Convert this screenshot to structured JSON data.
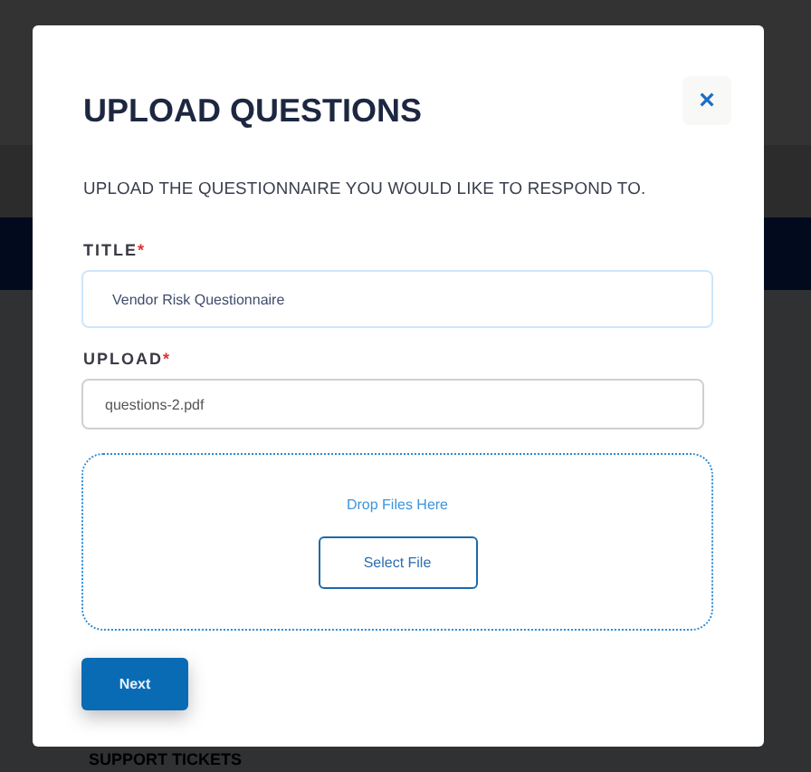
{
  "background": {
    "section_heading": "SUPPORT TICKETS"
  },
  "dialog": {
    "title": "UPLOAD QUESTIONS",
    "close": "×",
    "instructions": "UPLOAD THE QUESTIONNAIRE YOU WOULD LIKE TO RESPOND TO.",
    "fields": [
      {
        "label": "TITLE",
        "required_mark": "*",
        "value": "Vendor Risk Questionnaire",
        "focused": true
      },
      {
        "label": "UPLOAD",
        "required_mark": "*",
        "value": "questions-2.pdf",
        "focused": false
      }
    ],
    "dropzone": {
      "prompt": "Drop Files Here",
      "button": "Select File"
    },
    "submit": "Next"
  }
}
